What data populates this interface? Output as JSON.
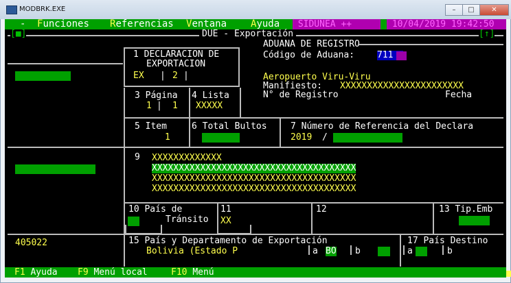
{
  "window": {
    "title": "MODBRK.EXE",
    "minimize": "–",
    "maximize": "□",
    "close": "✕"
  },
  "menubar": {
    "left_bracket": "-",
    "items": [
      {
        "hotkey": "F",
        "rest": "unciones"
      },
      {
        "hotkey": "R",
        "rest": "eferencias"
      },
      {
        "hotkey": "V",
        "rest": "entana"
      },
      {
        "hotkey": "A",
        "rest": "yuda"
      }
    ],
    "system": "SIDUNEA ++",
    "datetime": "10/04/2019 19:42:50"
  },
  "frame": {
    "title": "DUE - Exportación",
    "left_marker": "[■]",
    "right_marker": "[↑]"
  },
  "left_panel": {
    "code": "405022"
  },
  "aduana": {
    "header": "ADUANA DE REGISTRO",
    "codigo_label": "Código de Aduana:",
    "codigo_value": "711",
    "nombre": "Aeropuerto Viru-Viru",
    "manifiesto_label": "Manifiesto:",
    "manifiesto_value": "XXXXXXXXXXXXXXXXXXXXXXX",
    "registro_label": "N° de Registro",
    "fecha_label": "Fecha"
  },
  "box1": {
    "label_line1": "1 DECLARACION DE",
    "label_line2": "EXPORTACION",
    "ex": "EX",
    "sep1": "|",
    "num": "2",
    "sep2": "|"
  },
  "box3": {
    "label": "3 Página",
    "value_a": "1",
    "sep": "|",
    "value_b": "1"
  },
  "box4": {
    "label": "4 Lista",
    "value": "XXXXX"
  },
  "box5": {
    "label": "5 Item",
    "value": "1"
  },
  "box6": {
    "label": "6 Total Bultos"
  },
  "box7": {
    "label": "7 Número de Referencia del Declara",
    "year": "2019",
    "slash": "/"
  },
  "box9": {
    "label": "9",
    "line1": "XXXXXXXXXXXXX",
    "line2": "XXXXXXXXXXXXXXXXXXXXXXXXXXXXXXXXXXXXXX",
    "line3": "XXXXXXXXXXXXXXXXXXXXXXXXXXXXXXXXXXXXXX",
    "line4": "XXXXXXXXXXXXXXXXXXXXXXXXXXXXXXXXXXXXXX"
  },
  "box10": {
    "label_line1": "10 País de",
    "label_line2": "Tránsito"
  },
  "box11": {
    "label": "11",
    "value": "XX"
  },
  "box12": {
    "label": "12"
  },
  "box13": {
    "label": "13 Tip.Emb"
  },
  "box15": {
    "label": "15 País y Departamento de Exportación",
    "value": "Bolivia (Estado P",
    "a_label": "a",
    "a_value": "BO",
    "b_label": "b"
  },
  "box17": {
    "label": "17 País Destino",
    "a_label": "a",
    "b_label": "b"
  },
  "statusbar": {
    "f1_key": "F1",
    "f1_label": "Ayuda",
    "f9_key": "F9",
    "f9_label": "Menú local",
    "f10_key": "F10",
    "f10_label": "Menú"
  }
}
